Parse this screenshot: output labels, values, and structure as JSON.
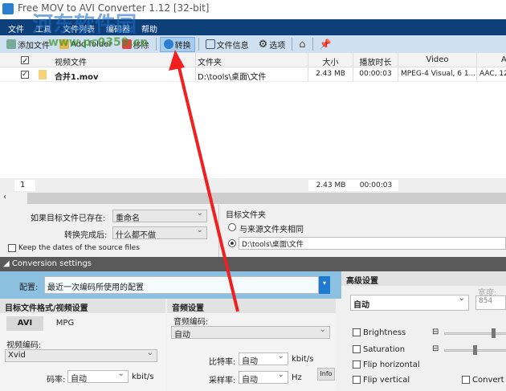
{
  "window": {
    "title": "Free MOV to AVI Converter 1.12  [32-bit]"
  },
  "watermark": {
    "name": "河东软件园",
    "url": "www.pc0359.cn"
  },
  "menu": [
    "文件",
    "工具",
    "文件列表",
    "编码器",
    "帮助"
  ],
  "toolbar": {
    "add_file": "添加文件",
    "add_folder": "Add folder",
    "remove": "移除",
    "convert": "转换",
    "file_info": "文件信息",
    "options": "选项"
  },
  "table": {
    "headers": [
      "视频文件",
      "文件夹",
      "大小",
      "播放时长",
      "Video",
      "A"
    ],
    "rows": [
      {
        "checked": true,
        "file": "合并1.mov",
        "folder": "D:\\tools\\桌面\\文件",
        "size": "2.43 MB",
        "duration": "00:00:03",
        "video": "MPEG-4 Visual, 6 1...",
        "audio": "AAC, 12"
      }
    ],
    "footer": {
      "count": "1",
      "size": "2.43 MB",
      "duration": "00:00:03"
    }
  },
  "options": {
    "if_exists_label": "如果目标文件已存在:",
    "if_exists_value": "重命名",
    "after_label": "转换完成后:",
    "after_value": "什么都不做",
    "keep_dates": "Keep the dates of the source files",
    "target_folder_label": "目标文件夹",
    "same_as_source": "与来源文件夹相同",
    "folder_path": "D:\\tools\\桌面\\文件"
  },
  "conversion": {
    "title": "Conversion settings",
    "config_label": "配置:",
    "config_value": "最近一次编码所使用的配置",
    "format_header": "目标文件格式/视频设置",
    "tabs": [
      "AVI",
      "MPG"
    ],
    "video_codec_label": "视频编码:",
    "video_codec": "Xvid",
    "bitrate_label": "码率:",
    "bitrate": "自动",
    "bitrate_unit": "kbit/s",
    "audio_header": "音频设置",
    "audio_codec_label": "音频编码:",
    "audio_codec": "自动",
    "audio_bitrate_label": "比特率:",
    "audio_bitrate": "自动",
    "audio_bitrate_unit": "kbit/s",
    "samplerate_label": "采样率:",
    "samplerate": "自动",
    "samplerate_unit": "Hz",
    "info": "Info",
    "advanced_header": "高级设置",
    "resolution": "自动",
    "width_label": "宽度:",
    "width": "854",
    "checks": [
      "Brightness",
      "Saturation",
      "Flip horizontal",
      "Flip vertical"
    ],
    "convert_c": "Convert co"
  }
}
